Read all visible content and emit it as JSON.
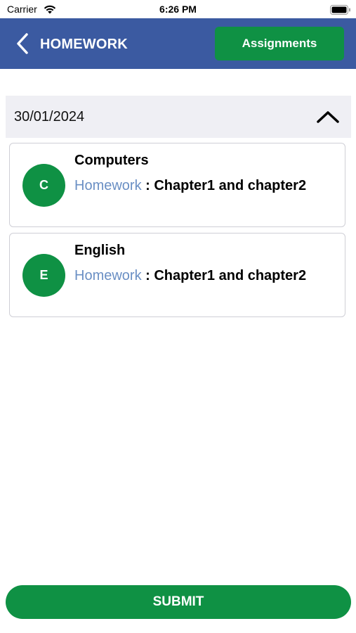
{
  "status_bar": {
    "carrier": "Carrier",
    "time": "6:26 PM",
    "wifi_icon": "wifi-icon",
    "battery_icon": "battery-icon"
  },
  "header": {
    "title": "HOMEWORK",
    "back_icon": "chevron-left-icon",
    "assignments_label": "Assignments",
    "background_color": "#3b5aa1",
    "button_color": "#0f9144"
  },
  "date_section": {
    "date": "30/01/2024",
    "toggle_icon": "chevron-up-icon",
    "expanded": true
  },
  "homework_items": [
    {
      "initial": "C",
      "subject": "Computers",
      "label": "Homework",
      "separator": " : ",
      "description": "Chapter1 and chapter2"
    },
    {
      "initial": "E",
      "subject": "English",
      "label": "Homework",
      "separator": " : ",
      "description": "Chapter1 and chapter2"
    }
  ],
  "footer": {
    "submit_label": "SUBMIT"
  },
  "colors": {
    "accent_green": "#0f9144",
    "link_blue": "#6a8fc4",
    "date_row_bg": "#efeff4"
  }
}
